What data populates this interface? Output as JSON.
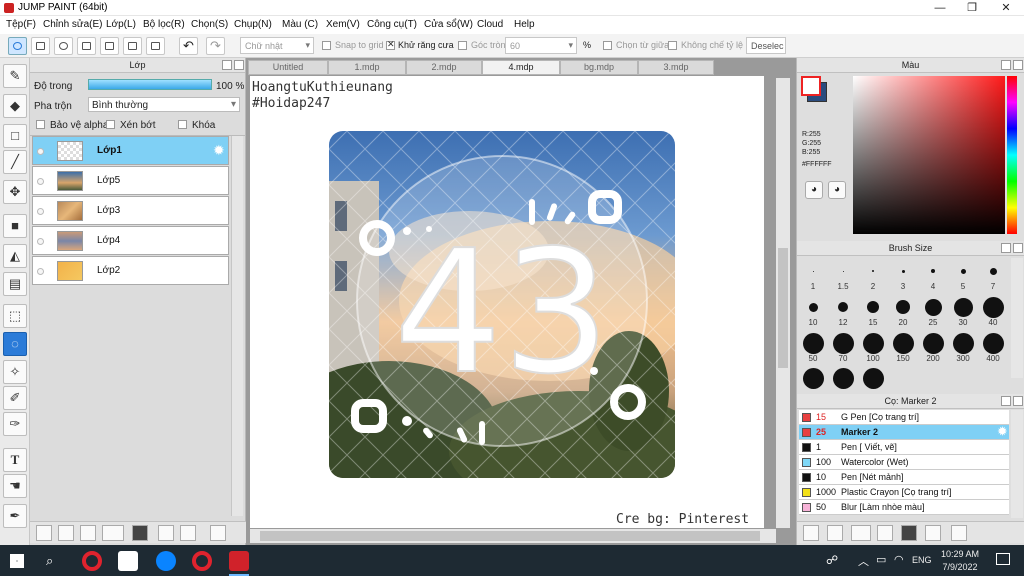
{
  "window": {
    "title": "JUMP PAINT (64bit)",
    "minimize": "—",
    "restore": "❐",
    "close": "✕"
  },
  "menu": [
    "Tệp(F)",
    "Chỉnh sửa(E)",
    "Lớp(L)",
    "Bộ lọc(R)",
    "Chọn(S)",
    "Chụp(N)",
    "Màu (C)",
    "Xem(V)",
    "Công cụ(T)",
    "Cửa sổ(W)",
    "Cloud",
    "Help"
  ],
  "toolbar": {
    "shape_select": "Chữ nhật",
    "snap_to_grid": "Snap to grid",
    "antialias": "Khử răng cưa",
    "corner_round": "Góc tròn",
    "corner_value": "60",
    "percent": "%",
    "select_from_center": "Chọn từ giữa",
    "constrain_ratio": "Không chế tỷ lệ",
    "deselect": "Deselec"
  },
  "layer_panel": {
    "title": "Lớp",
    "opacity_label": "Độ trong",
    "opacity_value": "100 %",
    "blend_label": "Pha trộn",
    "blend_value": "Bình thường",
    "protect_alpha": "Bảo vệ alpha",
    "clipping": "Xén bớt",
    "lock": "Khóa",
    "layers": [
      {
        "name": "Lớp1",
        "active": true
      },
      {
        "name": "Lớp5"
      },
      {
        "name": "Lớp3"
      },
      {
        "name": "Lớp4"
      },
      {
        "name": "Lớp2"
      }
    ]
  },
  "tabs": [
    "Untitled",
    "1.mdp",
    "2.mdp",
    "4.mdp",
    "bg.mdp",
    "3.mdp"
  ],
  "active_tab": "4.mdp",
  "canvas": {
    "text_top1": "HoangtuKuthieunang",
    "text_top2": "#Hoidap247",
    "credit": "Cre bg: Pinterest",
    "number": "43"
  },
  "color_panel": {
    "title": "Màu",
    "r": "R:255",
    "g": "G:255",
    "b": "B:255",
    "hex": "#FFFFFF"
  },
  "brush_panel": {
    "title": "Brush Size",
    "sizes": [
      "1",
      "1.5",
      "2",
      "3",
      "4",
      "5",
      "7",
      "10",
      "12",
      "15",
      "20",
      "25",
      "30",
      "40",
      "50",
      "70",
      "100",
      "150",
      "200",
      "300",
      "400"
    ]
  },
  "brush_list": {
    "title": "Cọ: Marker 2",
    "items": [
      {
        "size": "15",
        "name": "G Pen [Cọ trang trí]",
        "color": "#e84040"
      },
      {
        "size": "25",
        "name": "Marker 2",
        "color": "#e84040",
        "active": true
      },
      {
        "size": "1",
        "name": "Pen [ Viết, vẽ]",
        "color": "#111111"
      },
      {
        "size": "100",
        "name": "Watercolor (Wet)",
        "color": "#7fd8f7"
      },
      {
        "size": "10",
        "name": "Pen [Nét mảnh]",
        "color": "#111111"
      },
      {
        "size": "1000",
        "name": "Plastic Crayon [Cọ trang trí]",
        "color": "#f2e017"
      },
      {
        "size": "50",
        "name": "Blur [Làm nhòe màu]",
        "color": "#f7b3d8"
      }
    ]
  },
  "taskbar": {
    "time": "10:29 AM",
    "date": "7/9/2022",
    "lang": "ENG"
  },
  "colors": {
    "accent": "#2b7bd8",
    "active_layer": "#7fd0f5",
    "taskbar": "#1e2a33"
  }
}
